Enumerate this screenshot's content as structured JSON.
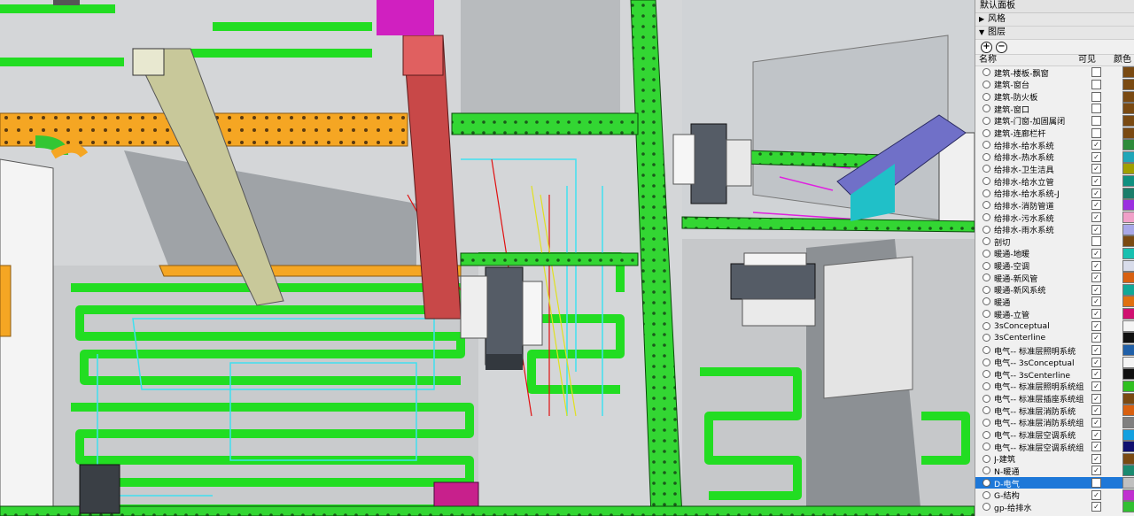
{
  "panel": {
    "title": "默认面板",
    "sections": [
      {
        "label": "风格",
        "expanded": false
      },
      {
        "label": "图层",
        "expanded": true
      }
    ],
    "toolbar": {
      "add_icon": "plus-circle-icon",
      "remove_icon": "minus-circle-icon"
    },
    "columns": {
      "name": "名称",
      "visible": "可见",
      "color": "颜色"
    },
    "layers": [
      {
        "name": "建筑-楼板-飘窗",
        "visible": false,
        "color": "#7a4a12"
      },
      {
        "name": "建筑-窗台",
        "visible": false,
        "color": "#7a4a12"
      },
      {
        "name": "建筑-防火板",
        "visible": false,
        "color": "#7a4a12"
      },
      {
        "name": "建筑-窗口",
        "visible": false,
        "color": "#7a4a12"
      },
      {
        "name": "建筑-门窗-加固属闭",
        "visible": false,
        "color": "#7a4a12"
      },
      {
        "name": "建筑-连廊栏杆",
        "visible": false,
        "color": "#7a4a12"
      },
      {
        "name": "给排水-给水系统",
        "visible": true,
        "color": "#2e8b3a"
      },
      {
        "name": "给排水-热水系统",
        "visible": true,
        "color": "#1fa6b8"
      },
      {
        "name": "给排水-卫生洁具",
        "visible": true,
        "color": "#a0a000"
      },
      {
        "name": "给排水-给水立管",
        "visible": true,
        "color": "#0f9080"
      },
      {
        "name": "给排水-给水系统-J",
        "visible": true,
        "color": "#1a7d6a"
      },
      {
        "name": "给排水-消防管道",
        "visible": true,
        "color": "#9b30e0"
      },
      {
        "name": "给排水-污水系统",
        "visible": true,
        "color": "#f0a0c8"
      },
      {
        "name": "给排水-雨水系统",
        "visible": true,
        "color": "#a8a8e8"
      },
      {
        "name": "剖切",
        "visible": false,
        "color": "#7a4a12"
      },
      {
        "name": "暖通-地暖",
        "visible": true,
        "color": "#18c0b0"
      },
      {
        "name": "暖通-空调",
        "visible": true,
        "color": "#d8dcea"
      },
      {
        "name": "暖通-新风管",
        "visible": true,
        "color": "#d86010"
      },
      {
        "name": "暖通-新风系统",
        "visible": true,
        "color": "#10a898"
      },
      {
        "name": "暖通",
        "visible": true,
        "color": "#e07010"
      },
      {
        "name": "暖通-立管",
        "visible": true,
        "color": "#d01070"
      },
      {
        "name": "3sConceptual",
        "visible": true,
        "color": "#f4f4f4"
      },
      {
        "name": "3sCenterline",
        "visible": true,
        "color": "#101010"
      },
      {
        "name": "电气-- 标准层照明系统",
        "visible": true,
        "color": "#2060a8"
      },
      {
        "name": "电气-- 3sConceptual",
        "visible": true,
        "color": "#f4f4f4"
      },
      {
        "name": "电气-- 3sCenterline",
        "visible": true,
        "color": "#101010"
      },
      {
        "name": "电气-- 标准层照明系统组",
        "visible": true,
        "color": "#30c020"
      },
      {
        "name": "电气-- 标准层插座系统组",
        "visible": true,
        "color": "#7a4a12"
      },
      {
        "name": "电气-- 标准层消防系统",
        "visible": true,
        "color": "#d86010"
      },
      {
        "name": "电气-- 标准层消防系统组",
        "visible": true,
        "color": "#808080"
      },
      {
        "name": "电气-- 标准层空调系统",
        "visible": true,
        "color": "#14a0e0"
      },
      {
        "name": "电气-- 标准层空调系统组",
        "visible": true,
        "color": "#101070"
      },
      {
        "name": "J-建筑",
        "visible": true,
        "color": "#7a4a12"
      },
      {
        "name": "N-暖通",
        "visible": true,
        "color": "#1a8a70"
      },
      {
        "name": "D-电气",
        "visible": false,
        "color": "#c0c0c0",
        "selected": true
      },
      {
        "name": "G-结构",
        "visible": true,
        "color": "#c030d0"
      },
      {
        "name": "gp-给排水",
        "visible": true,
        "color": "#30c030"
      }
    ]
  }
}
